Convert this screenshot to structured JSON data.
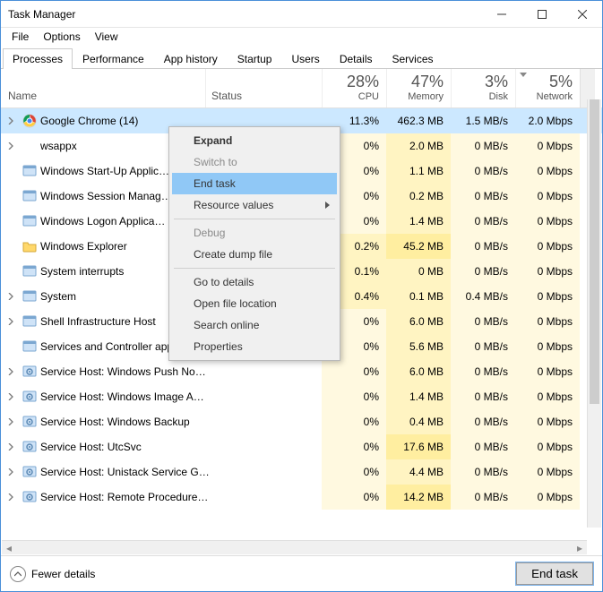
{
  "window": {
    "title": "Task Manager"
  },
  "menu": {
    "file": "File",
    "options": "Options",
    "view": "View"
  },
  "tabs": {
    "processes": "Processes",
    "performance": "Performance",
    "app_history": "App history",
    "startup": "Startup",
    "users": "Users",
    "details": "Details",
    "services": "Services"
  },
  "columns": {
    "name": "Name",
    "status": "Status",
    "cpu_pct": "28%",
    "cpu_lbl": "CPU",
    "mem_pct": "47%",
    "mem_lbl": "Memory",
    "disk_pct": "3%",
    "disk_lbl": "Disk",
    "net_pct": "5%",
    "net_lbl": "Network"
  },
  "context_menu": {
    "expand": "Expand",
    "switch_to": "Switch to",
    "end_task": "End task",
    "resource_values": "Resource values",
    "debug": "Debug",
    "create_dump": "Create dump file",
    "go_to_details": "Go to details",
    "open_file_location": "Open file location",
    "search_online": "Search online",
    "properties": "Properties"
  },
  "footer": {
    "fewer_details": "Fewer details",
    "end_task": "End task"
  },
  "rows": [
    {
      "name": "Google Chrome (14)",
      "cpu": "11.3%",
      "mem": "462.3 MB",
      "disk": "1.5 MB/s",
      "net": "2.0 Mbps",
      "expand": true,
      "selected": true,
      "icon": "chrome"
    },
    {
      "name": "wsappx",
      "cpu": "0%",
      "mem": "2.0 MB",
      "disk": "0 MB/s",
      "net": "0 Mbps",
      "expand": true,
      "icon": "blank"
    },
    {
      "name": "Windows Start-Up Applic…",
      "cpu": "0%",
      "mem": "1.1 MB",
      "disk": "0 MB/s",
      "net": "0 Mbps",
      "icon": "app"
    },
    {
      "name": "Windows Session Manag…",
      "cpu": "0%",
      "mem": "0.2 MB",
      "disk": "0 MB/s",
      "net": "0 Mbps",
      "icon": "app"
    },
    {
      "name": "Windows Logon Applica…",
      "cpu": "0%",
      "mem": "1.4 MB",
      "disk": "0 MB/s",
      "net": "0 Mbps",
      "icon": "app"
    },
    {
      "name": "Windows Explorer",
      "cpu": "0.2%",
      "mem": "45.2 MB",
      "disk": "0 MB/s",
      "net": "0 Mbps",
      "icon": "explorer"
    },
    {
      "name": "System interrupts",
      "cpu": "0.1%",
      "mem": "0 MB",
      "disk": "0 MB/s",
      "net": "0 Mbps",
      "icon": "app"
    },
    {
      "name": "System",
      "cpu": "0.4%",
      "mem": "0.1 MB",
      "disk": "0.4 MB/s",
      "net": "0 Mbps",
      "expand": true,
      "icon": "app"
    },
    {
      "name": "Shell Infrastructure Host",
      "cpu": "0%",
      "mem": "6.0 MB",
      "disk": "0 MB/s",
      "net": "0 Mbps",
      "expand": true,
      "icon": "app"
    },
    {
      "name": "Services and Controller app",
      "cpu": "0%",
      "mem": "5.6 MB",
      "disk": "0 MB/s",
      "net": "0 Mbps",
      "icon": "app"
    },
    {
      "name": "Service Host: Windows Push No…",
      "cpu": "0%",
      "mem": "6.0 MB",
      "disk": "0 MB/s",
      "net": "0 Mbps",
      "expand": true,
      "icon": "gear"
    },
    {
      "name": "Service Host: Windows Image A…",
      "cpu": "0%",
      "mem": "1.4 MB",
      "disk": "0 MB/s",
      "net": "0 Mbps",
      "expand": true,
      "icon": "gear"
    },
    {
      "name": "Service Host: Windows Backup",
      "cpu": "0%",
      "mem": "0.4 MB",
      "disk": "0 MB/s",
      "net": "0 Mbps",
      "expand": true,
      "icon": "gear"
    },
    {
      "name": "Service Host: UtcSvc",
      "cpu": "0%",
      "mem": "17.6 MB",
      "disk": "0 MB/s",
      "net": "0 Mbps",
      "expand": true,
      "icon": "gear"
    },
    {
      "name": "Service Host: Unistack Service G…",
      "cpu": "0%",
      "mem": "4.4 MB",
      "disk": "0 MB/s",
      "net": "0 Mbps",
      "expand": true,
      "icon": "gear"
    },
    {
      "name": "Service Host: Remote Procedure…",
      "cpu": "0%",
      "mem": "14.2 MB",
      "disk": "0 MB/s",
      "net": "0 Mbps",
      "expand": true,
      "icon": "gear"
    }
  ]
}
